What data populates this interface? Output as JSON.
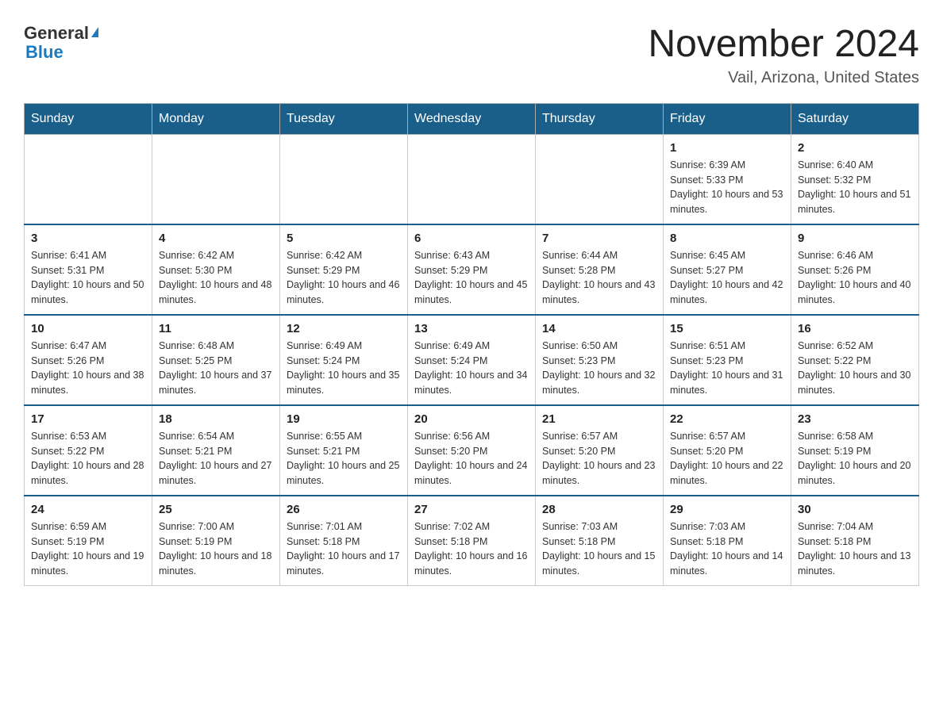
{
  "logo": {
    "text_general": "General",
    "text_blue": "Blue",
    "arrow": "▶"
  },
  "title": "November 2024",
  "subtitle": "Vail, Arizona, United States",
  "days_of_week": [
    "Sunday",
    "Monday",
    "Tuesday",
    "Wednesday",
    "Thursday",
    "Friday",
    "Saturday"
  ],
  "weeks": [
    [
      {
        "day": "",
        "info": ""
      },
      {
        "day": "",
        "info": ""
      },
      {
        "day": "",
        "info": ""
      },
      {
        "day": "",
        "info": ""
      },
      {
        "day": "",
        "info": ""
      },
      {
        "day": "1",
        "info": "Sunrise: 6:39 AM\nSunset: 5:33 PM\nDaylight: 10 hours and 53 minutes."
      },
      {
        "day": "2",
        "info": "Sunrise: 6:40 AM\nSunset: 5:32 PM\nDaylight: 10 hours and 51 minutes."
      }
    ],
    [
      {
        "day": "3",
        "info": "Sunrise: 6:41 AM\nSunset: 5:31 PM\nDaylight: 10 hours and 50 minutes."
      },
      {
        "day": "4",
        "info": "Sunrise: 6:42 AM\nSunset: 5:30 PM\nDaylight: 10 hours and 48 minutes."
      },
      {
        "day": "5",
        "info": "Sunrise: 6:42 AM\nSunset: 5:29 PM\nDaylight: 10 hours and 46 minutes."
      },
      {
        "day": "6",
        "info": "Sunrise: 6:43 AM\nSunset: 5:29 PM\nDaylight: 10 hours and 45 minutes."
      },
      {
        "day": "7",
        "info": "Sunrise: 6:44 AM\nSunset: 5:28 PM\nDaylight: 10 hours and 43 minutes."
      },
      {
        "day": "8",
        "info": "Sunrise: 6:45 AM\nSunset: 5:27 PM\nDaylight: 10 hours and 42 minutes."
      },
      {
        "day": "9",
        "info": "Sunrise: 6:46 AM\nSunset: 5:26 PM\nDaylight: 10 hours and 40 minutes."
      }
    ],
    [
      {
        "day": "10",
        "info": "Sunrise: 6:47 AM\nSunset: 5:26 PM\nDaylight: 10 hours and 38 minutes."
      },
      {
        "day": "11",
        "info": "Sunrise: 6:48 AM\nSunset: 5:25 PM\nDaylight: 10 hours and 37 minutes."
      },
      {
        "day": "12",
        "info": "Sunrise: 6:49 AM\nSunset: 5:24 PM\nDaylight: 10 hours and 35 minutes."
      },
      {
        "day": "13",
        "info": "Sunrise: 6:49 AM\nSunset: 5:24 PM\nDaylight: 10 hours and 34 minutes."
      },
      {
        "day": "14",
        "info": "Sunrise: 6:50 AM\nSunset: 5:23 PM\nDaylight: 10 hours and 32 minutes."
      },
      {
        "day": "15",
        "info": "Sunrise: 6:51 AM\nSunset: 5:23 PM\nDaylight: 10 hours and 31 minutes."
      },
      {
        "day": "16",
        "info": "Sunrise: 6:52 AM\nSunset: 5:22 PM\nDaylight: 10 hours and 30 minutes."
      }
    ],
    [
      {
        "day": "17",
        "info": "Sunrise: 6:53 AM\nSunset: 5:22 PM\nDaylight: 10 hours and 28 minutes."
      },
      {
        "day": "18",
        "info": "Sunrise: 6:54 AM\nSunset: 5:21 PM\nDaylight: 10 hours and 27 minutes."
      },
      {
        "day": "19",
        "info": "Sunrise: 6:55 AM\nSunset: 5:21 PM\nDaylight: 10 hours and 25 minutes."
      },
      {
        "day": "20",
        "info": "Sunrise: 6:56 AM\nSunset: 5:20 PM\nDaylight: 10 hours and 24 minutes."
      },
      {
        "day": "21",
        "info": "Sunrise: 6:57 AM\nSunset: 5:20 PM\nDaylight: 10 hours and 23 minutes."
      },
      {
        "day": "22",
        "info": "Sunrise: 6:57 AM\nSunset: 5:20 PM\nDaylight: 10 hours and 22 minutes."
      },
      {
        "day": "23",
        "info": "Sunrise: 6:58 AM\nSunset: 5:19 PM\nDaylight: 10 hours and 20 minutes."
      }
    ],
    [
      {
        "day": "24",
        "info": "Sunrise: 6:59 AM\nSunset: 5:19 PM\nDaylight: 10 hours and 19 minutes."
      },
      {
        "day": "25",
        "info": "Sunrise: 7:00 AM\nSunset: 5:19 PM\nDaylight: 10 hours and 18 minutes."
      },
      {
        "day": "26",
        "info": "Sunrise: 7:01 AM\nSunset: 5:18 PM\nDaylight: 10 hours and 17 minutes."
      },
      {
        "day": "27",
        "info": "Sunrise: 7:02 AM\nSunset: 5:18 PM\nDaylight: 10 hours and 16 minutes."
      },
      {
        "day": "28",
        "info": "Sunrise: 7:03 AM\nSunset: 5:18 PM\nDaylight: 10 hours and 15 minutes."
      },
      {
        "day": "29",
        "info": "Sunrise: 7:03 AM\nSunset: 5:18 PM\nDaylight: 10 hours and 14 minutes."
      },
      {
        "day": "30",
        "info": "Sunrise: 7:04 AM\nSunset: 5:18 PM\nDaylight: 10 hours and 13 minutes."
      }
    ]
  ]
}
